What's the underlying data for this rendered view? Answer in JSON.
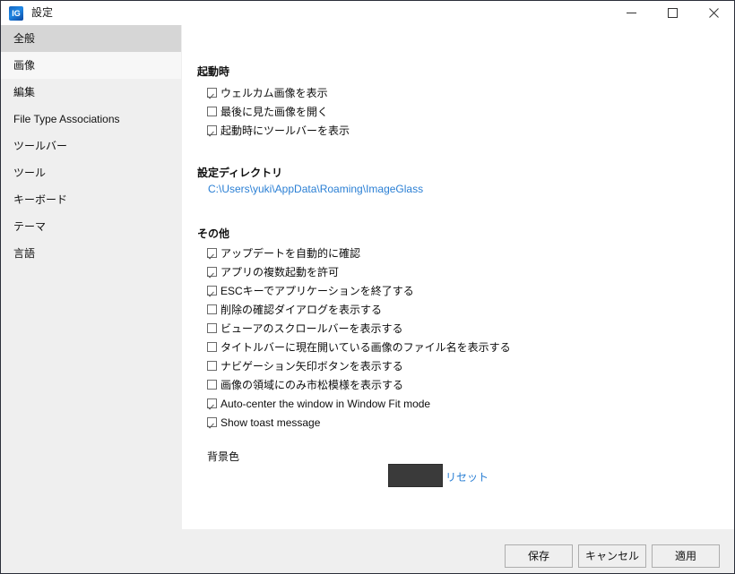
{
  "window": {
    "title": "設定",
    "app_icon": "imageglass-icon",
    "icon_glyph": "IG",
    "controls": {
      "minimize": "minimize-icon",
      "maximize": "maximize-icon",
      "close": "close-icon"
    }
  },
  "sidebar": {
    "items": [
      {
        "label": "全般",
        "state": "selected"
      },
      {
        "label": "画像",
        "state": "hovered"
      },
      {
        "label": "編集",
        "state": "normal"
      },
      {
        "label": "File Type Associations",
        "state": "normal"
      },
      {
        "label": "ツールバー",
        "state": "normal"
      },
      {
        "label": "ツール",
        "state": "normal"
      },
      {
        "label": "キーボード",
        "state": "normal"
      },
      {
        "label": "テーマ",
        "state": "normal"
      },
      {
        "label": "言語",
        "state": "normal"
      }
    ]
  },
  "content": {
    "startup": {
      "title": "起動時",
      "options": [
        {
          "label": "ウェルカム画像を表示",
          "checked": true
        },
        {
          "label": "最後に見た画像を開く",
          "checked": false
        },
        {
          "label": "起動時にツールバーを表示",
          "checked": true
        }
      ]
    },
    "config_dir": {
      "title": "設定ディレクトリ",
      "path": "C:\\Users\\yuki\\AppData\\Roaming\\ImageGlass"
    },
    "other": {
      "title": "その他",
      "options": [
        {
          "label": "アップデートを自動的に確認",
          "checked": true
        },
        {
          "label": "アプリの複数起動を許可",
          "checked": true
        },
        {
          "label": "ESCキーでアプリケーションを終了する",
          "checked": true
        },
        {
          "label": "削除の確認ダイアログを表示する",
          "checked": false
        },
        {
          "label": "ビューアのスクロールバーを表示する",
          "checked": false
        },
        {
          "label": "タイトルバーに現在開いている画像のファイル名を表示する",
          "checked": false
        },
        {
          "label": "ナビゲーション矢印ボタンを表示する",
          "checked": false
        },
        {
          "label": "画像の領域にのみ市松模様を表示する",
          "checked": false
        },
        {
          "label": "Auto-center the window in Window Fit mode",
          "checked": true
        },
        {
          "label": "Show toast message",
          "checked": true
        }
      ]
    },
    "background_color": {
      "title": "背景色",
      "color": "#3A3A3A",
      "reset_label": "リセット"
    }
  },
  "footer": {
    "save_label": "保存",
    "cancel_label": "キャンセル",
    "apply_label": "適用"
  },
  "theme": {
    "sidebar_bg": "#EFEFEF",
    "selected_bg": "#D6D6D6",
    "hover_bg": "#F7F7F7",
    "panel_bg": "#FFFFFF",
    "link_color": "#2A7FD4"
  }
}
